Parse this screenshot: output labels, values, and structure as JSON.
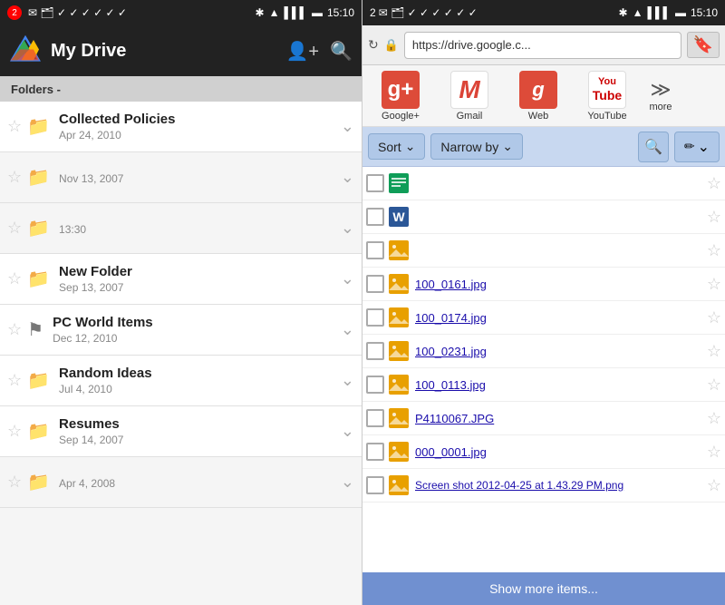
{
  "left": {
    "status_bar": {
      "badge": "2",
      "time": "15:10"
    },
    "header": {
      "title": "My Drive"
    },
    "folders_label": "Folders -",
    "folders": [
      {
        "id": "collected-policies",
        "name": "Collected Policies",
        "date": "Apr 24, 2010",
        "type": "folder",
        "has_flag": false
      },
      {
        "id": "unnamed-1",
        "name": "",
        "date": "Nov 13, 2007",
        "type": "folder",
        "has_flag": false
      },
      {
        "id": "unnamed-2",
        "name": "",
        "date": "13:30",
        "type": "folder",
        "has_flag": false
      },
      {
        "id": "new-folder",
        "name": "New Folder",
        "date": "Sep 13, 2007",
        "type": "folder",
        "has_flag": false
      },
      {
        "id": "pc-world-items",
        "name": "PC World Items",
        "date": "Dec 12, 2010",
        "type": "folder",
        "has_flag": true
      },
      {
        "id": "random-ideas",
        "name": "Random Ideas",
        "date": "Jul 4, 2010",
        "type": "folder",
        "has_flag": false
      },
      {
        "id": "resumes",
        "name": "Resumes",
        "date": "Sep 14, 2007",
        "type": "folder",
        "has_flag": false
      },
      {
        "id": "unnamed-3",
        "name": "",
        "date": "Apr 4, 2008",
        "type": "folder",
        "has_flag": false
      }
    ]
  },
  "right": {
    "status_bar": {
      "badge": "2",
      "time": "15:10"
    },
    "browser": {
      "url": "https://drive.google.c...",
      "url_placeholder": "https://drive.google.c..."
    },
    "bookmarks": [
      {
        "id": "google-plus",
        "label": "Google+",
        "icon": "g+"
      },
      {
        "id": "gmail",
        "label": "Gmail",
        "icon": "gmail"
      },
      {
        "id": "web",
        "label": "Web",
        "icon": "web"
      },
      {
        "id": "youtube",
        "label": "YouTube",
        "icon": "youtube"
      },
      {
        "id": "more",
        "label": "more",
        "icon": "more"
      }
    ],
    "toolbar": {
      "sort_label": "Sort",
      "narrow_label": "Narrow by"
    },
    "files": [
      {
        "id": "sheets-icon",
        "name": "",
        "type": "sheets",
        "is_link": false
      },
      {
        "id": "word-icon",
        "name": "",
        "type": "word",
        "is_link": false
      },
      {
        "id": "img-icon-1",
        "name": "",
        "type": "image",
        "is_link": false
      },
      {
        "id": "100_0161",
        "name": "100_0161.jpg",
        "type": "image",
        "is_link": true
      },
      {
        "id": "100_0174",
        "name": "100_0174.jpg",
        "type": "image",
        "is_link": true
      },
      {
        "id": "100_0231",
        "name": "100_0231.jpg",
        "type": "image",
        "is_link": true
      },
      {
        "id": "100_0113",
        "name": "100_0113.jpg",
        "type": "image",
        "is_link": true
      },
      {
        "id": "P4110067",
        "name": "P4110067.JPG",
        "type": "image",
        "is_link": true
      },
      {
        "id": "000_0001",
        "name": "000_0001.jpg",
        "type": "image",
        "is_link": true
      },
      {
        "id": "screenshot",
        "name": "Screen shot 2012-04-25 at 1.43.29 PM.png",
        "type": "image",
        "is_link": true
      }
    ],
    "show_more_label": "Show more items..."
  }
}
